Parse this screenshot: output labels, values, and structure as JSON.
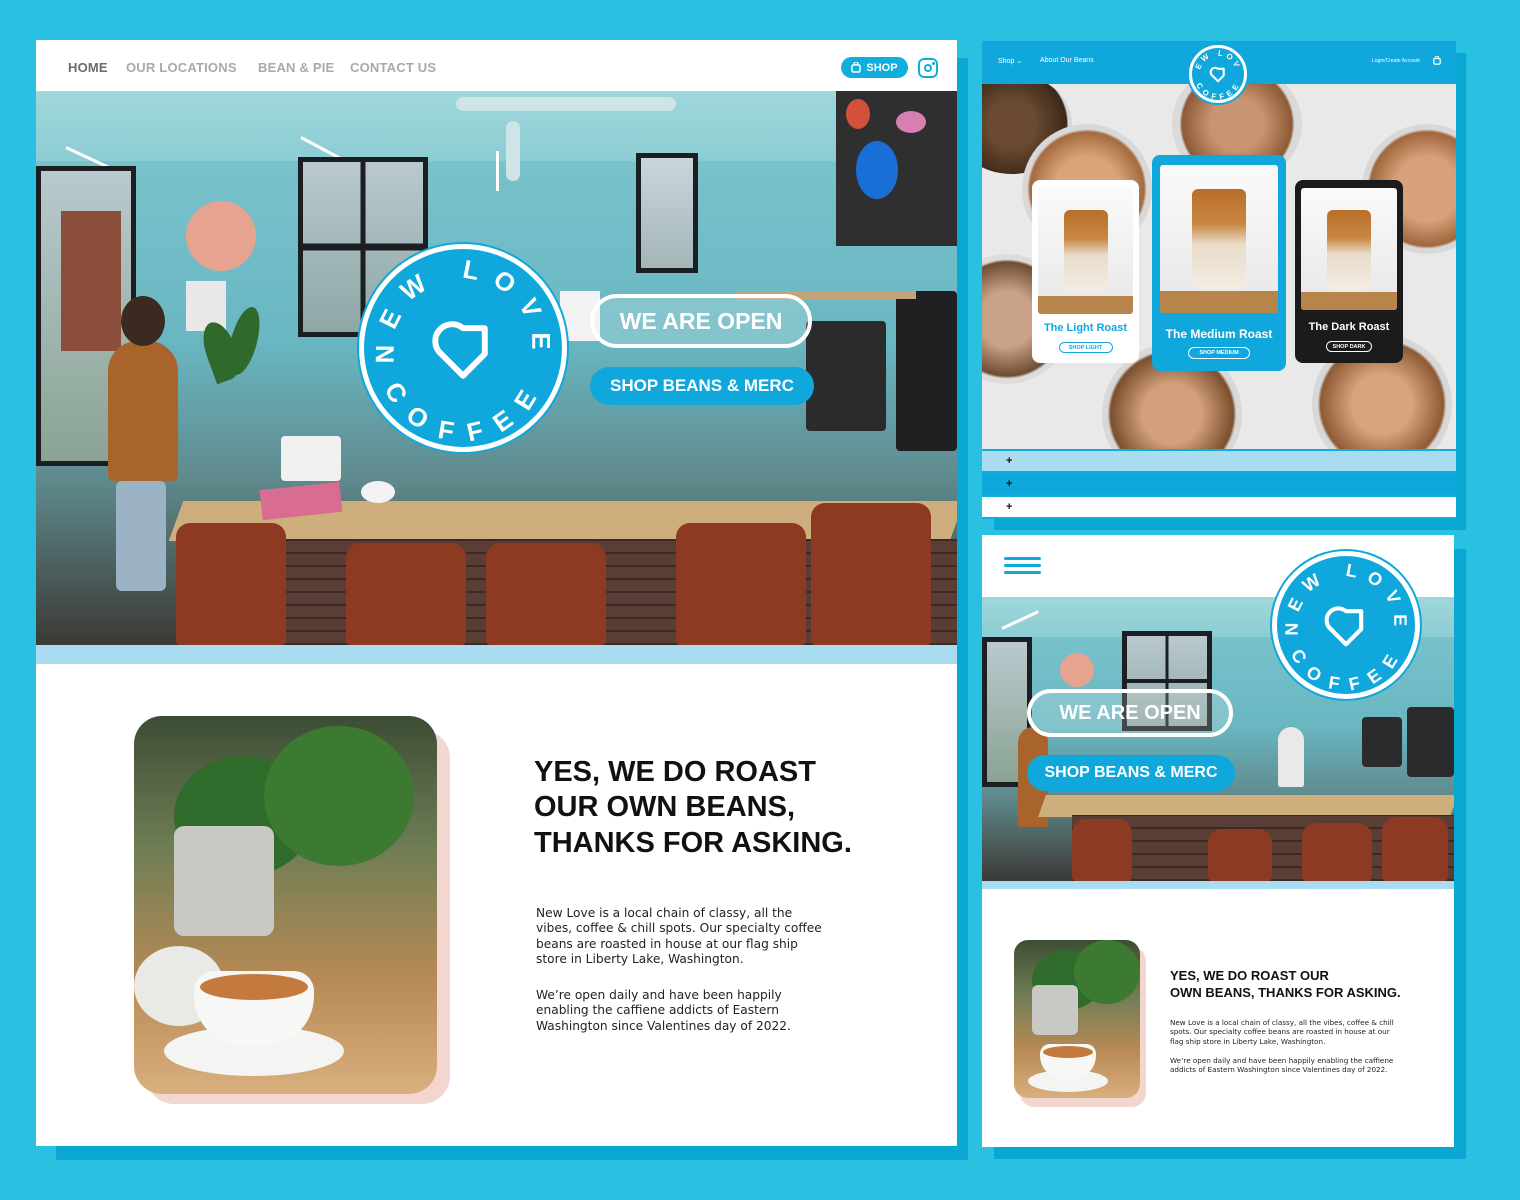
{
  "desktop": {
    "nav": {
      "home": "HOME",
      "locations": "OUR LOCATIONS",
      "bean_pie": "BEAN & PIE",
      "contact": "CONTACT US",
      "shop": "SHOP"
    },
    "hero": {
      "badge_top": "NEW LOVE",
      "badge_bottom": "COFFEE",
      "open_label": "WE ARE OPEN",
      "shop_label": "SHOP BEANS & MERC"
    },
    "about": {
      "headline_1": "YES, WE DO ROAST",
      "headline_2": "OUR OWN BEANS,",
      "headline_3": "THANKS FOR ASKING.",
      "para1_l1": "New Love is a local chain of classy, all the",
      "para1_l2": "vibes, coffee & chill spots. Our specialty coffee",
      "para1_l3": "beans are roasted in house at our flag ship",
      "para1_l4": "store in Liberty Lake, Washington.",
      "para2_l1": "We’re open daily and have been happily",
      "para2_l2": "enabling the caffiene addicts of Eastern",
      "para2_l3": "Washington since Valentines day of 2022."
    }
  },
  "shop_page": {
    "nav": {
      "shop": "Shop",
      "about": "About Our Beans",
      "login": "Login/Create Account"
    },
    "badge_top": "NEW LOVE",
    "badge_bottom": "COFFEE",
    "cards": [
      {
        "title": "The Light Roast",
        "button": "SHOP LIGHT"
      },
      {
        "title": "The Medium Roast",
        "button": "SHOP MEDIUM"
      },
      {
        "title": "The Dark Roast",
        "button": "SHOP DARK"
      }
    ],
    "accordion": [
      "+",
      "+",
      "+"
    ]
  },
  "mobile": {
    "badge_top": "NEW LOVE",
    "badge_bottom": "COFFEE",
    "open_label": "WE ARE OPEN",
    "shop_label": "SHOP BEANS & MERC",
    "headline_1": "YES, WE DO ROAST OUR",
    "headline_2": "OWN BEANS, THANKS FOR ASKING.",
    "para1_l1": "New Love is a local chain of classy, all the vibes, coffee & chill",
    "para1_l2": "spots. Our specialty coffee beans are roasted in house at our",
    "para1_l3": "flag ship store in Liberty Lake, Washington.",
    "para2_l1": "We’re open daily and have been happily enabling the caffiene",
    "para2_l2": "addicts of Eastern Washington since Valentines day of 2022."
  },
  "colors": {
    "background": "#29c0e1",
    "brand_blue": "#10a8dc",
    "light_blue": "#a9dcf1",
    "blush": "#f3d6d0",
    "dark_card": "#1b1b1b"
  }
}
